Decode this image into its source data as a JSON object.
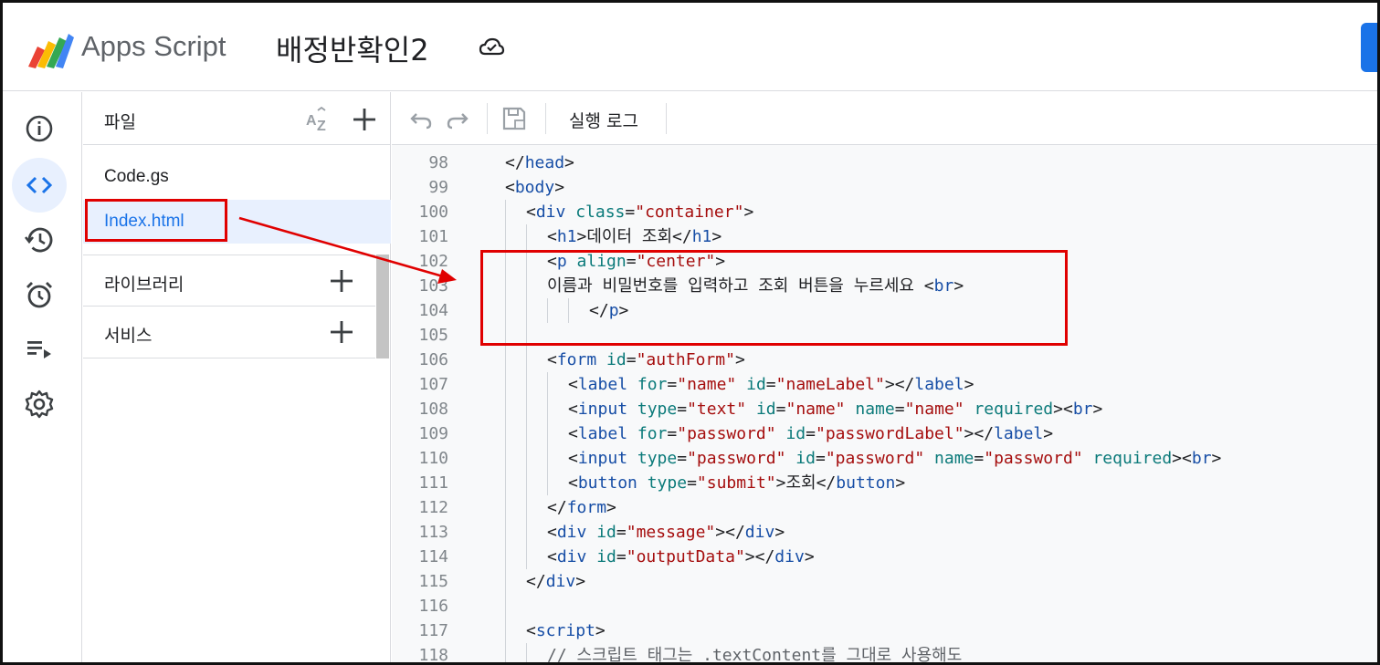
{
  "header": {
    "app_name": "Apps Script",
    "project_title": "배정반확인2",
    "accent_color": "#1a73e8"
  },
  "rail": {
    "items": [
      {
        "icon": "info-icon",
        "active": false
      },
      {
        "icon": "code-icon",
        "active": true
      },
      {
        "icon": "history-icon",
        "active": false
      },
      {
        "icon": "alarm-icon",
        "active": false
      },
      {
        "icon": "executions-icon",
        "active": false
      },
      {
        "icon": "gear-icon",
        "active": false
      }
    ]
  },
  "files": {
    "title": "파일",
    "items": [
      {
        "label": "Code.gs",
        "selected": false
      },
      {
        "label": "Index.html",
        "selected": true
      }
    ],
    "libraries_label": "라이브러리",
    "services_label": "서비스"
  },
  "toolbar": {
    "run_log_label": "실행 로그"
  },
  "editor": {
    "lines": [
      {
        "n": "98",
        "tokens": [
          [
            "t",
            "</"
          ],
          [
            "g",
            "head"
          ],
          [
            "t",
            ">"
          ]
        ],
        "indent": 1
      },
      {
        "n": "99",
        "tokens": [
          [
            "t",
            "<"
          ],
          [
            "g",
            "body"
          ],
          [
            "t",
            ">"
          ]
        ],
        "indent": 1
      },
      {
        "n": "100",
        "tokens": [
          [
            "t",
            "<"
          ],
          [
            "g",
            "div"
          ],
          [
            "x",
            " "
          ],
          [
            "a",
            "class"
          ],
          [
            "t",
            "="
          ],
          [
            "s",
            "\"container\""
          ],
          [
            "t",
            ">"
          ]
        ],
        "indent": 2
      },
      {
        "n": "101",
        "tokens": [
          [
            "t",
            "<"
          ],
          [
            "g",
            "h1"
          ],
          [
            "t",
            ">"
          ],
          [
            "x",
            "데이터 조회"
          ],
          [
            "t",
            "</"
          ],
          [
            "g",
            "h1"
          ],
          [
            "t",
            ">"
          ]
        ],
        "indent": 3
      },
      {
        "n": "102",
        "tokens": [
          [
            "t",
            "<"
          ],
          [
            "g",
            "p"
          ],
          [
            "x",
            " "
          ],
          [
            "a",
            "align"
          ],
          [
            "t",
            "="
          ],
          [
            "s",
            "\"center\""
          ],
          [
            "t",
            ">"
          ]
        ],
        "indent": 3
      },
      {
        "n": "103",
        "tokens": [
          [
            "x",
            "이름과 비밀번호를 입력하고 조회 버튼을 누르세요 "
          ],
          [
            "t",
            "<"
          ],
          [
            "g",
            "br"
          ],
          [
            "t",
            ">"
          ]
        ],
        "indent": 3
      },
      {
        "n": "104",
        "tokens": [
          [
            "t",
            "</"
          ],
          [
            "g",
            "p"
          ],
          [
            "t",
            ">"
          ]
        ],
        "indent": 5
      },
      {
        "n": "105",
        "tokens": [],
        "indent": 3
      },
      {
        "n": "106",
        "tokens": [
          [
            "t",
            "<"
          ],
          [
            "g",
            "form"
          ],
          [
            "x",
            " "
          ],
          [
            "a",
            "id"
          ],
          [
            "t",
            "="
          ],
          [
            "s",
            "\"authForm\""
          ],
          [
            "t",
            ">"
          ]
        ],
        "indent": 3
      },
      {
        "n": "107",
        "tokens": [
          [
            "t",
            "<"
          ],
          [
            "g",
            "label"
          ],
          [
            "x",
            " "
          ],
          [
            "a",
            "for"
          ],
          [
            "t",
            "="
          ],
          [
            "s",
            "\"name\""
          ],
          [
            "x",
            " "
          ],
          [
            "a",
            "id"
          ],
          [
            "t",
            "="
          ],
          [
            "s",
            "\"nameLabel\""
          ],
          [
            "t",
            "></"
          ],
          [
            "g",
            "label"
          ],
          [
            "t",
            ">"
          ]
        ],
        "indent": 4
      },
      {
        "n": "108",
        "tokens": [
          [
            "t",
            "<"
          ],
          [
            "g",
            "input"
          ],
          [
            "x",
            " "
          ],
          [
            "a",
            "type"
          ],
          [
            "t",
            "="
          ],
          [
            "s",
            "\"text\""
          ],
          [
            "x",
            " "
          ],
          [
            "a",
            "id"
          ],
          [
            "t",
            "="
          ],
          [
            "s",
            "\"name\""
          ],
          [
            "x",
            " "
          ],
          [
            "a",
            "name"
          ],
          [
            "t",
            "="
          ],
          [
            "s",
            "\"name\""
          ],
          [
            "x",
            " "
          ],
          [
            "a",
            "required"
          ],
          [
            "t",
            "><"
          ],
          [
            "g",
            "br"
          ],
          [
            "t",
            ">"
          ]
        ],
        "indent": 4
      },
      {
        "n": "109",
        "tokens": [
          [
            "t",
            "<"
          ],
          [
            "g",
            "label"
          ],
          [
            "x",
            " "
          ],
          [
            "a",
            "for"
          ],
          [
            "t",
            "="
          ],
          [
            "s",
            "\"password\""
          ],
          [
            "x",
            " "
          ],
          [
            "a",
            "id"
          ],
          [
            "t",
            "="
          ],
          [
            "s",
            "\"passwordLabel\""
          ],
          [
            "t",
            "></"
          ],
          [
            "g",
            "label"
          ],
          [
            "t",
            ">"
          ]
        ],
        "indent": 4
      },
      {
        "n": "110",
        "tokens": [
          [
            "t",
            "<"
          ],
          [
            "g",
            "input"
          ],
          [
            "x",
            " "
          ],
          [
            "a",
            "type"
          ],
          [
            "t",
            "="
          ],
          [
            "s",
            "\"password\""
          ],
          [
            "x",
            " "
          ],
          [
            "a",
            "id"
          ],
          [
            "t",
            "="
          ],
          [
            "s",
            "\"password\""
          ],
          [
            "x",
            " "
          ],
          [
            "a",
            "name"
          ],
          [
            "t",
            "="
          ],
          [
            "s",
            "\"password\""
          ],
          [
            "x",
            " "
          ],
          [
            "a",
            "required"
          ],
          [
            "t",
            "><"
          ],
          [
            "g",
            "br"
          ],
          [
            "t",
            ">"
          ]
        ],
        "indent": 4
      },
      {
        "n": "111",
        "tokens": [
          [
            "t",
            "<"
          ],
          [
            "g",
            "button"
          ],
          [
            "x",
            " "
          ],
          [
            "a",
            "type"
          ],
          [
            "t",
            "="
          ],
          [
            "s",
            "\"submit\""
          ],
          [
            "t",
            ">"
          ],
          [
            "x",
            "조회"
          ],
          [
            "t",
            "</"
          ],
          [
            "g",
            "button"
          ],
          [
            "t",
            ">"
          ]
        ],
        "indent": 4
      },
      {
        "n": "112",
        "tokens": [
          [
            "t",
            "</"
          ],
          [
            "g",
            "form"
          ],
          [
            "t",
            ">"
          ]
        ],
        "indent": 3
      },
      {
        "n": "113",
        "tokens": [
          [
            "t",
            "<"
          ],
          [
            "g",
            "div"
          ],
          [
            "x",
            " "
          ],
          [
            "a",
            "id"
          ],
          [
            "t",
            "="
          ],
          [
            "s",
            "\"message\""
          ],
          [
            "t",
            "></"
          ],
          [
            "g",
            "div"
          ],
          [
            "t",
            ">"
          ]
        ],
        "indent": 3
      },
      {
        "n": "114",
        "tokens": [
          [
            "t",
            "<"
          ],
          [
            "g",
            "div"
          ],
          [
            "x",
            " "
          ],
          [
            "a",
            "id"
          ],
          [
            "t",
            "="
          ],
          [
            "s",
            "\"outputData\""
          ],
          [
            "t",
            "></"
          ],
          [
            "g",
            "div"
          ],
          [
            "t",
            ">"
          ]
        ],
        "indent": 3
      },
      {
        "n": "115",
        "tokens": [
          [
            "t",
            "</"
          ],
          [
            "g",
            "div"
          ],
          [
            "t",
            ">"
          ]
        ],
        "indent": 2
      },
      {
        "n": "116",
        "tokens": [],
        "indent": 2
      },
      {
        "n": "117",
        "tokens": [
          [
            "t",
            "<"
          ],
          [
            "g",
            "script"
          ],
          [
            "t",
            ">"
          ]
        ],
        "indent": 2
      },
      {
        "n": "118",
        "tokens": [
          [
            "c",
            "// 스크립트 태그는 .textContent를 그대로 사용해도"
          ]
        ],
        "indent": 3
      }
    ]
  },
  "annotation_color": "#e00000"
}
